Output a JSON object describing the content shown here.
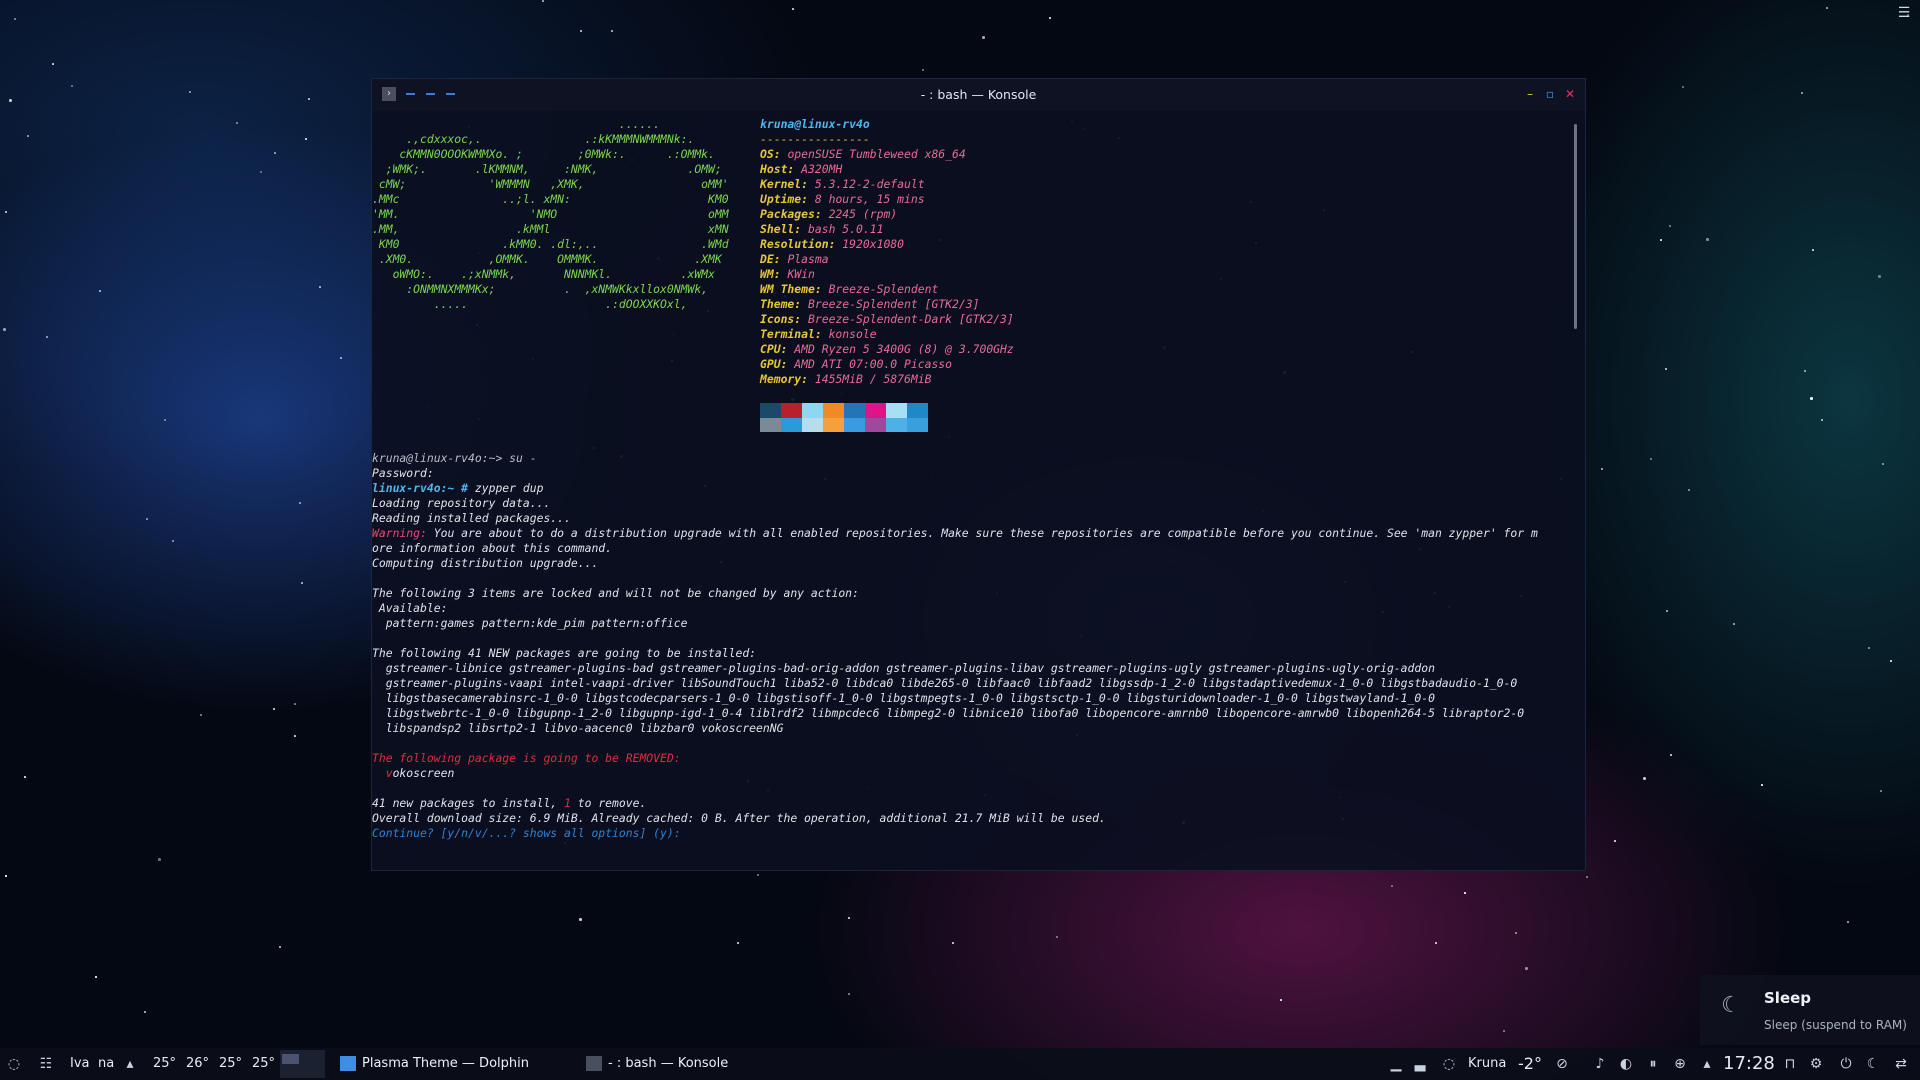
{
  "window": {
    "title": "- : bash — Konsole",
    "close_glyph": "✕",
    "maximize_glyph": "▫",
    "minimize_glyph": "–"
  },
  "neofetch": {
    "art": [
      "                                    ......",
      "     .,cdxxxoc,.               .:kKMMMNWMMMNk:.",
      "    cKMMN0OOOKWMMXo. ;        ;0MWk:.      .:OMMk.",
      "  ;WMK;.       .lKMMNM,     :NMK,             .OMW;",
      " cMW;            'WMMMN   ,XMK,                 oMM'",
      ".MMc               ..;l. xMN:                    KM0",
      "'MM.                   'NMO                      oMM",
      ".MM,                 .kMMl                       xMN",
      " KM0               .kMM0. .dl:,..               .WMd",
      " .XM0.           ,OMMK.    OMMMK.              .XMK",
      "   oWMO:.    .;xNMMk,       NNNMKl.          .xWMx",
      "     :ONMMNXMMMKx;          .  ,xNMWKkxllox0NMWk,",
      "         .....                    .:dOOXXKOxl,"
    ],
    "user_host": "kruna@linux-rv4o",
    "separator": "----------------",
    "info": [
      {
        "label": "OS",
        "value": "openSUSE Tumbleweed x86_64"
      },
      {
        "label": "Host",
        "value": "A320MH"
      },
      {
        "label": "Kernel",
        "value": "5.3.12-2-default"
      },
      {
        "label": "Uptime",
        "value": "8 hours, 15 mins"
      },
      {
        "label": "Packages",
        "value": "2245 (rpm)"
      },
      {
        "label": "Shell",
        "value": "bash 5.0.11"
      },
      {
        "label": "Resolution",
        "value": "1920x1080"
      },
      {
        "label": "DE",
        "value": "Plasma"
      },
      {
        "label": "WM",
        "value": "KWin"
      },
      {
        "label": "WM Theme",
        "value": "Breeze-Splendent"
      },
      {
        "label": "Theme",
        "value": "Breeze-Splendent [GTK2/3]"
      },
      {
        "label": "Icons",
        "value": "Breeze-Splendent-Dark [GTK2/3]"
      },
      {
        "label": "Terminal",
        "value": "konsole"
      },
      {
        "label": "CPU",
        "value": "AMD Ryzen 5 3400G (8) @ 3.700GHz"
      },
      {
        "label": "GPU",
        "value": "AMD ATI 07:00.0 Picasso"
      },
      {
        "label": "Memory",
        "value": "1455MiB / 5876MiB"
      }
    ],
    "palette": [
      "#1c4a66",
      "#b8212b",
      "#8fd6f0",
      "#f08a24",
      "#2474b8",
      "#e0148a",
      "#a5e0f5",
      "#1e88c9",
      "#7a8a99",
      "#2a9bd8",
      "#b7dced",
      "#f5a03a",
      "#3a9be0",
      "#a0489e",
      "#4db0e6",
      "#3aa0dd"
    ]
  },
  "session": {
    "prompt_user": "kruna@linux-rv4o:~> su -",
    "password": "Password:",
    "root_prompt": "linux-rv4o:~ #",
    "root_cmd": " zypper dup",
    "loading": "Loading repository data...",
    "reading": "Reading installed packages...",
    "warning_label": "Warning:",
    "warning_text_1": " You are about to do a distribution upgrade with all enabled repositories. Make sure these repositories are compatible before you continue. See 'man zypper' for m",
    "warning_text_2": "ore information about this command.",
    "computing": "Computing distribution upgrade...",
    "locked_header": "The following 3 items are locked and will not be changed by any action:",
    "available": " Available:",
    "locked_items": "  pattern:games pattern:kde_pim pattern:office",
    "new_header": "The following 41 NEW packages are going to be installed:",
    "new_1": "  gstreamer-libnice gstreamer-plugins-bad gstreamer-plugins-bad-orig-addon gstreamer-plugins-libav gstreamer-plugins-ugly gstreamer-plugins-ugly-orig-addon",
    "new_2": "  gstreamer-plugins-vaapi intel-vaapi-driver libSoundTouch1 liba52-0 libdca0 libde265-0 libfaac0 libfaad2 libgssdp-1_2-0 libgstadaptivedemux-1_0-0 libgstbadaudio-1_0-0",
    "new_3": "  libgstbasecamerabinsrc-1_0-0 libgstcodecparsers-1_0-0 libgstisoff-1_0-0 libgstmpegts-1_0-0 libgstsctp-1_0-0 libgsturidownloader-1_0-0 libgstwayland-1_0-0",
    "new_4": "  libgstwebrtc-1_0-0 libgupnp-1_2-0 libgupnp-igd-1_0-4 liblrdf2 libmpcdec6 libmpeg2-0 libnice10 libofa0 libopencore-amrnb0 libopencore-amrwb0 libopenh264-5 libraptor2-0",
    "new_5": "  libspandsp2 libsrtp2-1 libvo-aacenc0 libzbar0 vokoscreenNG",
    "removed_header": "The following package is going to be REMOVED:",
    "removed_first": "  v",
    "removed_rest": "okoscreen",
    "summary_a": "41 new packages to install, ",
    "summary_b": "1",
    "summary_c": " to remove.",
    "download": "Overall download size: 6.9 MiB. Already cached: 0 B. After the operation, additional 21.7 MiB will be used.",
    "continue": "Continue? [y/n/v/...? shows all options] (y):"
  },
  "osd": {
    "title": "Sleep",
    "subtitle": "Sleep (suspend to RAM)",
    "icon": "moon-icon"
  },
  "taskbar": {
    "weather_a": "Iva",
    "weather_b": "na",
    "temps": [
      "25°",
      "26°",
      "25°",
      "25°"
    ],
    "tasks": [
      {
        "label": "Plasma Theme — Dolphin",
        "icon": "folder-icon"
      },
      {
        "label": "- : bash — Konsole",
        "icon": "terminal-icon"
      }
    ],
    "user": "Kruna",
    "weather_now": "-2°",
    "clock": "17:28"
  }
}
